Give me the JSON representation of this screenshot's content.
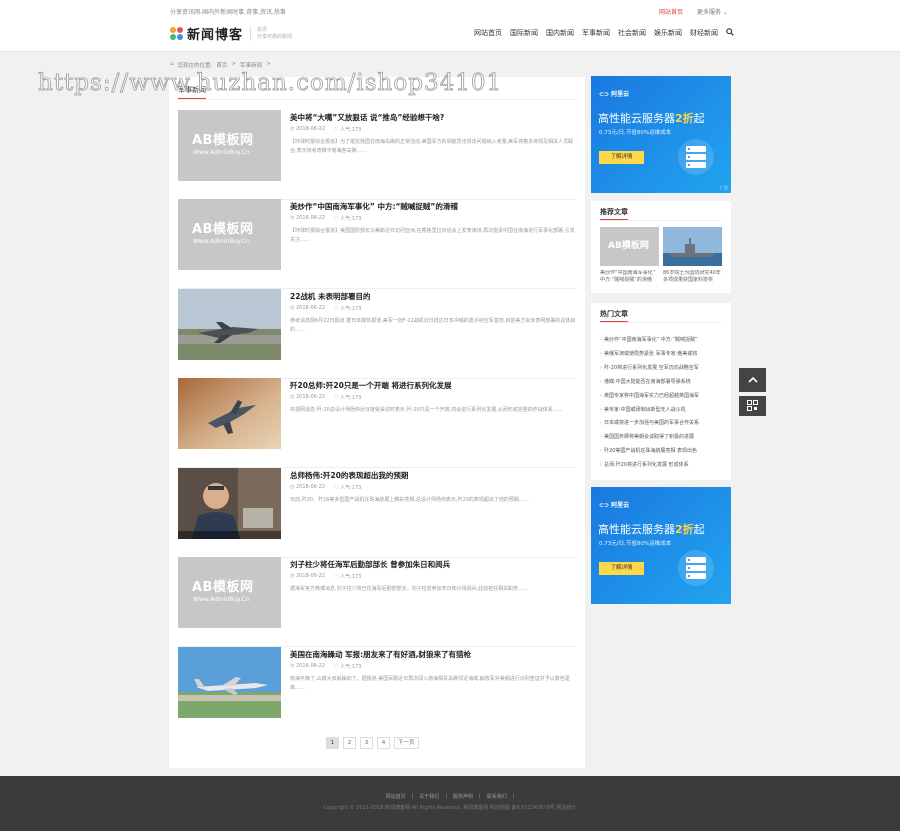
{
  "topbar": {
    "slogan": "分享资讯网-国内外新闻时事,奇事,资讯,热事",
    "home_link": "网站首页",
    "more_link": "更多服务",
    "logo_text": "新闻博客",
    "logo_sub_1": "资讯",
    "logo_sub_2": "分享可靠的新闻"
  },
  "nav": {
    "items": [
      "网站首页",
      "国际新闻",
      "国内新闻",
      "军事新闻",
      "社会新闻",
      "娱乐新闻",
      "财经新闻"
    ]
  },
  "breadcrumb": {
    "prefix": "您现在的位置:",
    "home": "首页",
    "sep": ">",
    "current": "军事新闻",
    "sep2": ">"
  },
  "main": {
    "section_title": "军事新闻",
    "articles": [
      {
        "title": "美中将“大嘴”又放狠话 说“推岛”经验想干啥?",
        "date": "2018-06-22",
        "views": "人气:173",
        "summary": "【环球时报综合报道】为了抵抗我国在南海岛礁的正常活动,美国军方的领航员也将该问题纳入考量,美军将着多将领及相关人员联合,表示将考虑推平南海各岛礁……",
        "thumb": "placeholder"
      },
      {
        "title": "美炒作“中国南海军事化” 中方:“贼喊捉贼”的滑稽",
        "date": "2018-06-22",
        "views": "人气:173",
        "summary": "【环球时报综合报道】美国国防部长马蒂斯近日访问亚洲,在香格里拉对话会上发表演讲,再次指责中国在南海进行军事化部署,引发关注……",
        "thumb": "placeholder"
      },
      {
        "title": "22战机 未表明部署目的",
        "date": "2018-06-22",
        "views": "人气:173",
        "summary": "参考消息网6月22日报道 据日本媒体报道,美军一批F-22战机近日抵达日本冲绳的嘉手纳空军基地,目前美方尚未表明部署的具体目的……",
        "thumb": "jet"
      },
      {
        "title": "歼20总师:歼20只是一个开端 将进行系列化发展",
        "date": "2018-06-22",
        "views": "人气:173",
        "summary": "央视网消息:歼-20总设计师杨伟近日接受采访时表示,歼-20只是一个开端,将会进行系列化发展,从而形成完整的作战体系……",
        "thumb": "j20"
      },
      {
        "title": "总师杨伟:歼20的表现超出我的预期",
        "date": "2018-06-22",
        "views": "人气:173",
        "summary": "日前,歼20、歼16等多型国产战机在珠海航展上精彩亮相,总设计师杨伟表示,歼20的表现超出了他的预期……",
        "thumb": "person"
      },
      {
        "title": "刘子柱少将任海军后勤部部长 曾参加朱日和阅兵",
        "date": "2018-06-22",
        "views": "人气:173",
        "summary": "据海军官方微博消息,刘子柱少将已任海军后勤部部长。刘子柱曾参加朱日和沙场阅兵,此前担任相关职务……",
        "thumb": "placeholder"
      },
      {
        "title": "美国在南海躁动 军报:朋友来了有好酒,豺狼来了有猎枪",
        "date": "2018-06-22",
        "views": "人气:173",
        "summary": "南海平静了,山姆大叔就躁动了。据报道,美国军舰近日再次闯入南海相关岛礁邻近海域,解放军对美舰进行识别查证并予以警告驱离……",
        "thumb": "bomber"
      }
    ],
    "placeholder_big": "AB模板网",
    "placeholder_small": "Www.AdminBuy.Cn",
    "pagination": [
      "1",
      "2",
      "3",
      "4",
      "下一页"
    ]
  },
  "sidebar": {
    "ad": {
      "logo": "阿里云",
      "title_pre": "高性能云服务器",
      "title_hl": "2折",
      "title_post": "起",
      "sub": "0.73元/日,节省80%运维成本",
      "button": "了解详情",
      "tag": "广告"
    },
    "recommend": {
      "title": "推荐文章",
      "items": [
        {
          "caption": "美炒作“中国南海军事化” 中方:“贼喊捉贼”的滑稽"
        },
        {
          "caption": "86岁院士为国防研究40年 多项成果获国家科技奖"
        }
      ]
    },
    "hot": {
      "title": "热门文章",
      "items": [
        "美炒作“中国南海军事化” 中方:“贼喊捉贼”",
        "美俄军演或使局势紧张 军事专家:俄美或将",
        "歼-20将进行系列化发展 空军迈向战略空军",
        "港媒:中国大陆能否在南海部署导弹系统",
        "英国专家称中国海军实力已经超越英国海军",
        "美专家:中国或研制出新型无人战斗机",
        "日本或将进一步加强与美国的军事合作关系",
        "美国国务卿称美朝会谈取得了积极的进展",
        "歼20等国产战机在珠海航展亮相 表现出色",
        "总师:歼20将进行系列化发展 形成体系"
      ]
    }
  },
  "watermark": "https://www.huzhan.com/ishop34101",
  "footer": {
    "links": [
      "网站首页",
      "关于我们",
      "服务声明",
      "联系我们"
    ],
    "copyright": "Copyright © 2011-2018 新闻博客网 All Rights Reserved. 新闻博客网 网站地图 备ICP12345678号 网站统计"
  },
  "colors": {
    "accent": "#e04040",
    "ad_blue": "#1a78e0",
    "footer_bg": "#3b3b3b"
  }
}
